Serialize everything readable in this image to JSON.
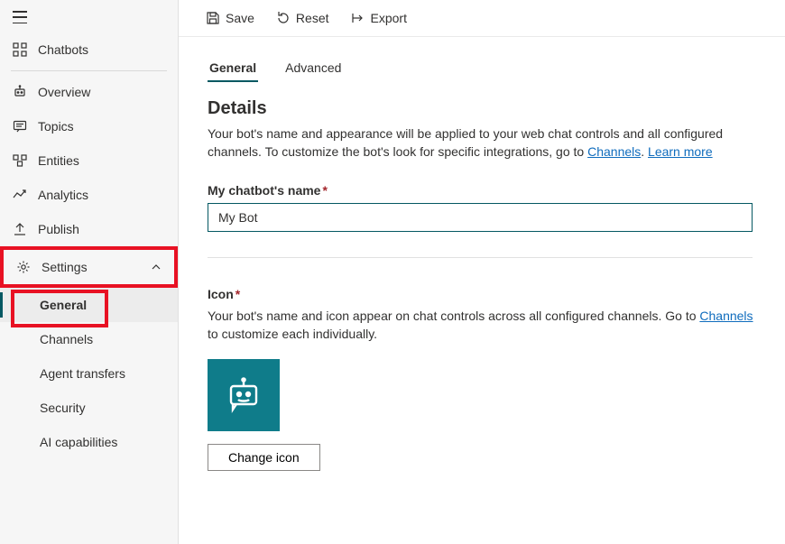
{
  "sidebar": {
    "chatbots": "Chatbots",
    "items": [
      {
        "label": "Overview"
      },
      {
        "label": "Topics"
      },
      {
        "label": "Entities"
      },
      {
        "label": "Analytics"
      },
      {
        "label": "Publish"
      }
    ],
    "settings": "Settings",
    "subitems": [
      {
        "label": "General"
      },
      {
        "label": "Channels"
      },
      {
        "label": "Agent transfers"
      },
      {
        "label": "Security"
      },
      {
        "label": "AI capabilities"
      }
    ]
  },
  "toolbar": {
    "save": "Save",
    "reset": "Reset",
    "export": "Export"
  },
  "tabs": {
    "general": "General",
    "advanced": "Advanced"
  },
  "details": {
    "heading": "Details",
    "desc_pre": "Your bot's name and appearance will be applied to your web chat controls and all configured channels. To customize the bot's look for specific integrations, go to ",
    "channels_link": "Channels",
    "dot_sep": ". ",
    "learn_more": "Learn more",
    "name_label": "My chatbot's name",
    "name_value": "My Bot",
    "icon_label": "Icon",
    "icon_desc_pre": "Your bot's name and icon appear on chat controls across all configured channels. Go to ",
    "icon_desc_post": " to customize each individually.",
    "change_icon": "Change icon"
  }
}
